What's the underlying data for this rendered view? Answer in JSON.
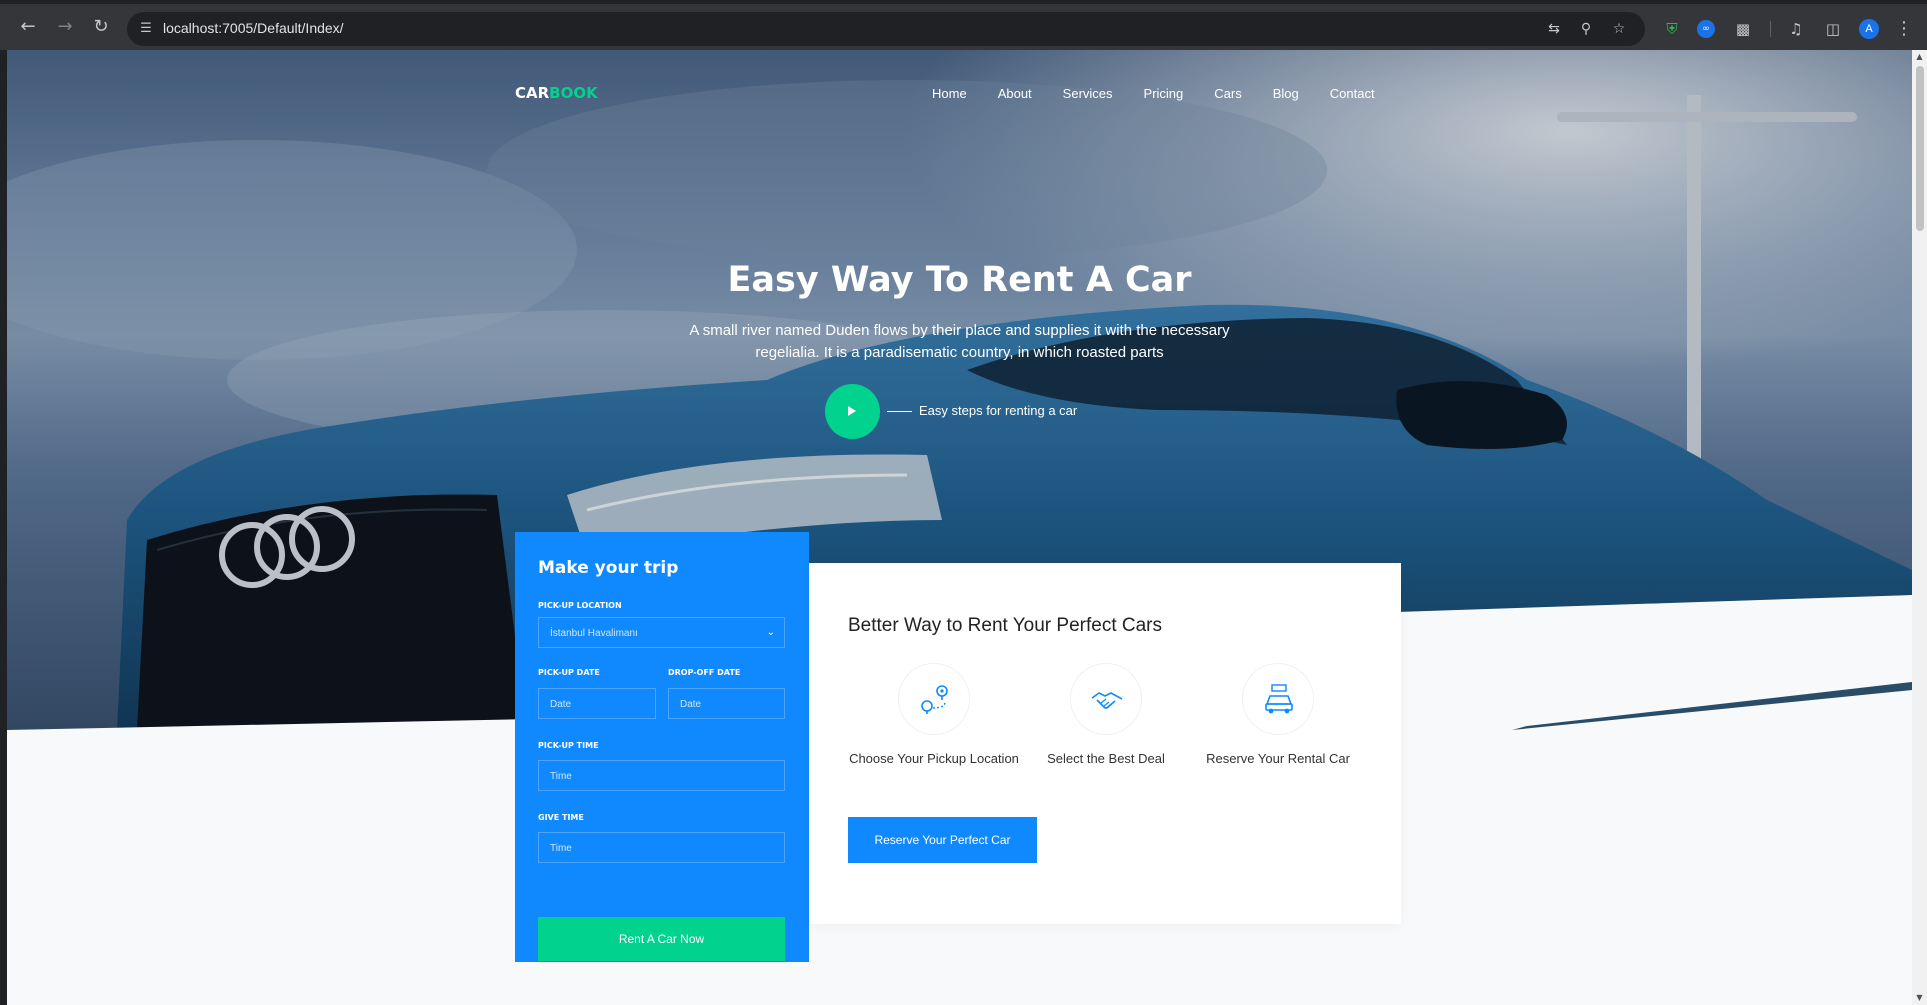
{
  "browser": {
    "url": "localhost:7005/Default/Index/",
    "profile_initial": "A",
    "icons": [
      "back-icon",
      "forward-icon",
      "reload-icon",
      "site-settings-icon",
      "translate-icon",
      "zoom-icon",
      "bookmark-star-icon",
      "shield-extension-icon",
      "loop-extension-icon",
      "extensions-puzzle-icon",
      "media-control-icon",
      "side-panel-icon",
      "menu-kebab-icon"
    ]
  },
  "nav": {
    "logo_part1": "CAR",
    "logo_part2": "BOOK",
    "items": [
      "Home",
      "About",
      "Services",
      "Pricing",
      "Cars",
      "Blog",
      "Contact"
    ]
  },
  "hero": {
    "title": "Easy Way To Rent A Car",
    "text": "A small river named Duden flows by their place and supplies it with the necessary regelialia. It is a paradisematic country, in which roasted parts",
    "steps_label": "Easy steps for renting a car"
  },
  "booking": {
    "title": "Make your trip",
    "pickup_location_label": "PICK-UP LOCATION",
    "pickup_location_value": "İstanbul Havalimanı",
    "pickup_date_label": "PICK-UP DATE",
    "pickup_date_placeholder": "Date",
    "dropoff_date_label": "DROP-OFF DATE",
    "dropoff_date_placeholder": "Date",
    "pickup_time_label": "PICK-UP TIME",
    "pickup_time_placeholder": "Time",
    "give_time_label": "GIVE TIME",
    "give_time_placeholder": "Time",
    "submit_label": "Rent A Car Now"
  },
  "services": {
    "heading": "Better Way to Rent Your Perfect Cars",
    "items": [
      {
        "label": "Choose Your Pickup Location",
        "icon": "route-pin-icon"
      },
      {
        "label": "Select the Best Deal",
        "icon": "handshake-icon"
      },
      {
        "label": "Reserve Your Rental Car",
        "icon": "rental-car-icon"
      }
    ],
    "button_label": "Reserve Your Perfect Car"
  },
  "colors": {
    "primary": "#1089ff",
    "accent": "#01d28e"
  }
}
